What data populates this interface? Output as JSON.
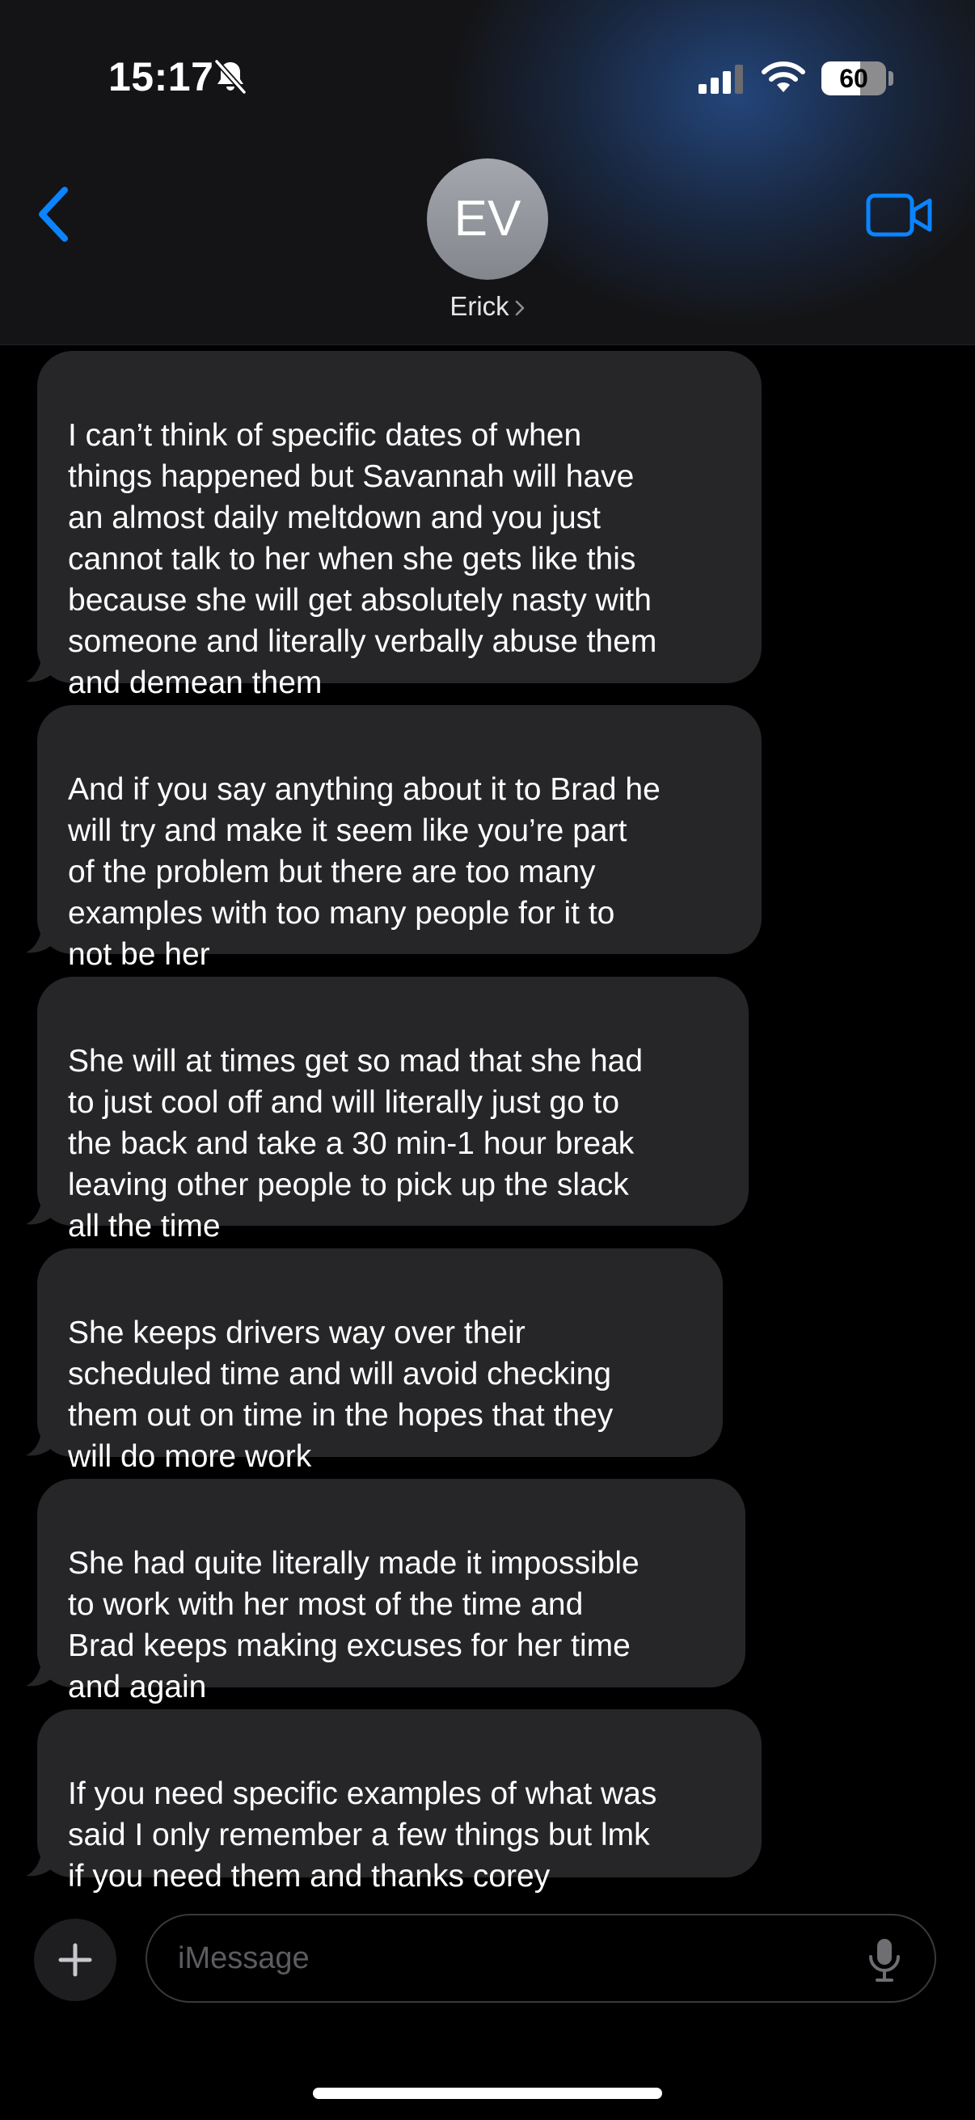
{
  "status_bar": {
    "time": "15:17",
    "battery_level": "60",
    "icons": [
      "bell-slash-icon",
      "signal-icon",
      "wifi-icon",
      "battery-icon"
    ]
  },
  "header": {
    "back_icon": "chevron-left-icon",
    "avatar_initials": "EV",
    "contact_name": "Erick",
    "video_icon": "video-camera-icon",
    "accent_color": "#0a84ff"
  },
  "messages": [
    {
      "text": "I can’t think of specific dates of when\nthings happened but Savannah will have\nan almost daily meltdown and you just\ncannot talk to her when she gets like this\nbecause she will get absolutely nasty with\nsomeone and literally verbally abuse them\nand demean them"
    },
    {
      "text": "And if you say anything about it to Brad he\nwill try and make it seem like you’re part\nof the problem but there are too many\nexamples with too many people for it to\nnot be her"
    },
    {
      "text": "She will at times get so mad that she had\nto just cool off and will literally just go to\nthe back and take a 30 min-1 hour break\nleaving other people to pick up the slack\nall the time"
    },
    {
      "text": "She keeps drivers way over their\nscheduled time and will avoid checking\nthem out on time in the hopes that they\nwill do more work"
    },
    {
      "text": "She had quite literally made it impossible\nto work with her most of the time and\nBrad keeps making excuses for her time\nand again"
    },
    {
      "text": "If you need specific examples of what was\nsaid I only remember a few things but lmk\nif you need them and thanks corey"
    }
  ],
  "compose": {
    "placeholder": "iMessage",
    "add_icon": "plus-icon",
    "mic_icon": "microphone-icon"
  },
  "colors": {
    "incoming_bubble": "#262628",
    "background": "#000000"
  }
}
